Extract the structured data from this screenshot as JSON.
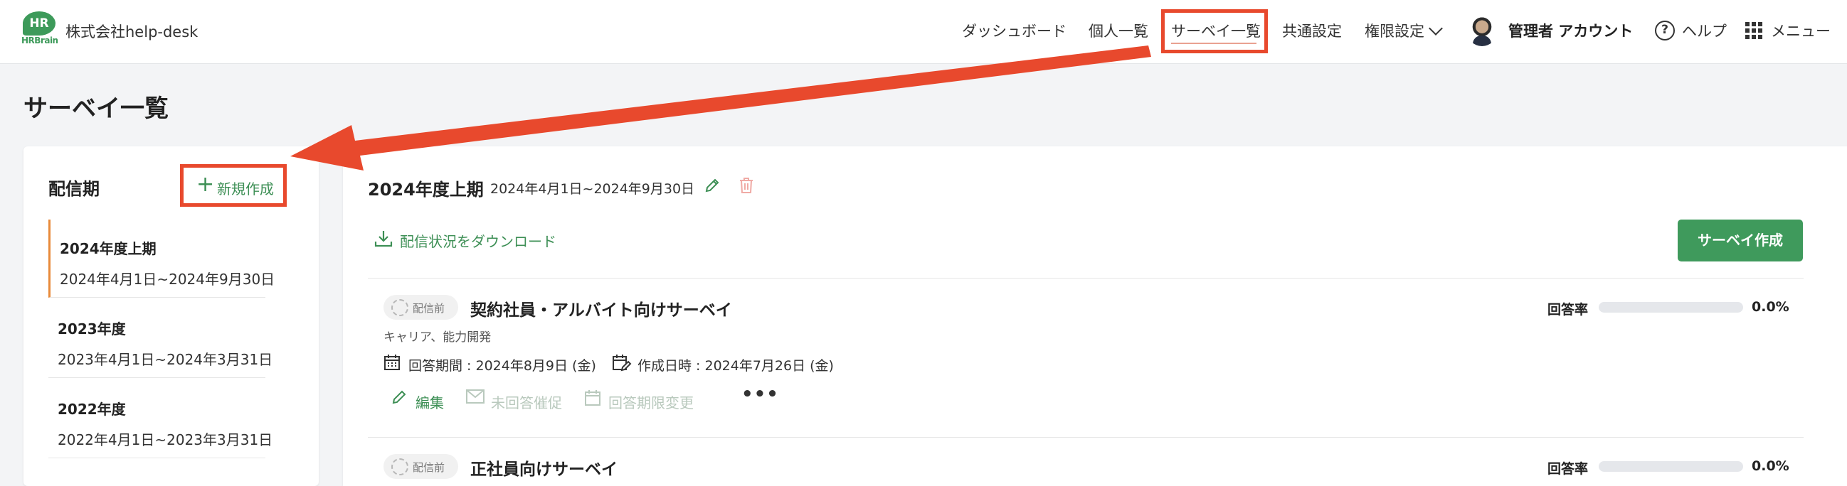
{
  "header": {
    "logo_text": "HR",
    "logo_brand": "HRBrain",
    "company": "株式会社help-desk",
    "nav": [
      {
        "label": "ダッシュボード"
      },
      {
        "label": "個人一覧"
      },
      {
        "label": "サーベイ一覧"
      },
      {
        "label": "共通設定"
      },
      {
        "label": "権限設定"
      }
    ],
    "account": "管理者 アカウント",
    "help": "ヘルプ",
    "menu": "メニュー"
  },
  "page": {
    "title": "サーベイ一覧"
  },
  "sidebar": {
    "title": "配信期",
    "new_button": "新規作成",
    "periods": [
      {
        "name": "2024年度上期",
        "range": "2024年4月1日~2024年9月30日"
      },
      {
        "name": "2023年度",
        "range": "2023年4月1日~2024年3月31日"
      },
      {
        "name": "2022年度",
        "range": "2022年4月1日~2023年3月31日"
      }
    ]
  },
  "main": {
    "period_title": "2024年度上期",
    "period_range": "2024年4月1日~2024年9月30日",
    "download_label": "配信状況をダウンロード",
    "create_button": "サーベイ作成",
    "surveys": [
      {
        "status": "配信前",
        "name": "契約社員・アルバイト向けサーベイ",
        "rate_label": "回答率",
        "rate_value": "0.0%",
        "rate_fraction": 0.0,
        "category": "キャリア、能力開発",
        "answer_period": "回答期間 : 2024年8月9日 (金)",
        "created_at": "作成日時 : 2024年7月26日 (金)",
        "actions": {
          "edit": "編集",
          "remind": "未回答催促",
          "change_deadline": "回答期限変更"
        }
      },
      {
        "status": "配信前",
        "name": "正社員向けサーベイ",
        "rate_label": "回答率",
        "rate_value": "0.0%",
        "rate_fraction": 0.0
      }
    ]
  },
  "colors": {
    "brand_green": "#3d9a5a",
    "annotation_red": "#e8492d",
    "active_period": "#e88a3a"
  }
}
